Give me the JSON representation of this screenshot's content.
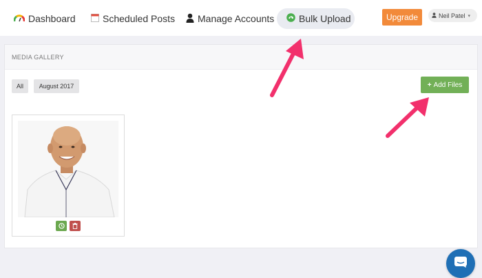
{
  "nav": {
    "dashboard": {
      "label": "Dashboard",
      "icon": "speedometer-icon"
    },
    "scheduled": {
      "label": "Scheduled Posts",
      "icon": "calendar-icon"
    },
    "manage": {
      "label": "Manage Accounts",
      "icon": "user-icon"
    },
    "bulk": {
      "label": "Bulk Upload",
      "icon": "upload-cloud-icon",
      "active": true
    }
  },
  "header": {
    "upgrade_label": "Upgrade",
    "user_name": "Neil Patel"
  },
  "gallery": {
    "title": "MEDIA GALLERY",
    "filters": [
      "All",
      "August 2017"
    ],
    "add_files_label": "Add Files",
    "items": [
      {
        "type": "image",
        "actions": [
          "clock-icon",
          "trash-icon"
        ]
      }
    ]
  },
  "colors": {
    "upgrade": "#f28a3a",
    "add_files": "#72b057",
    "annotation_arrow": "#f2306c",
    "chat": "#1f6fb5"
  }
}
